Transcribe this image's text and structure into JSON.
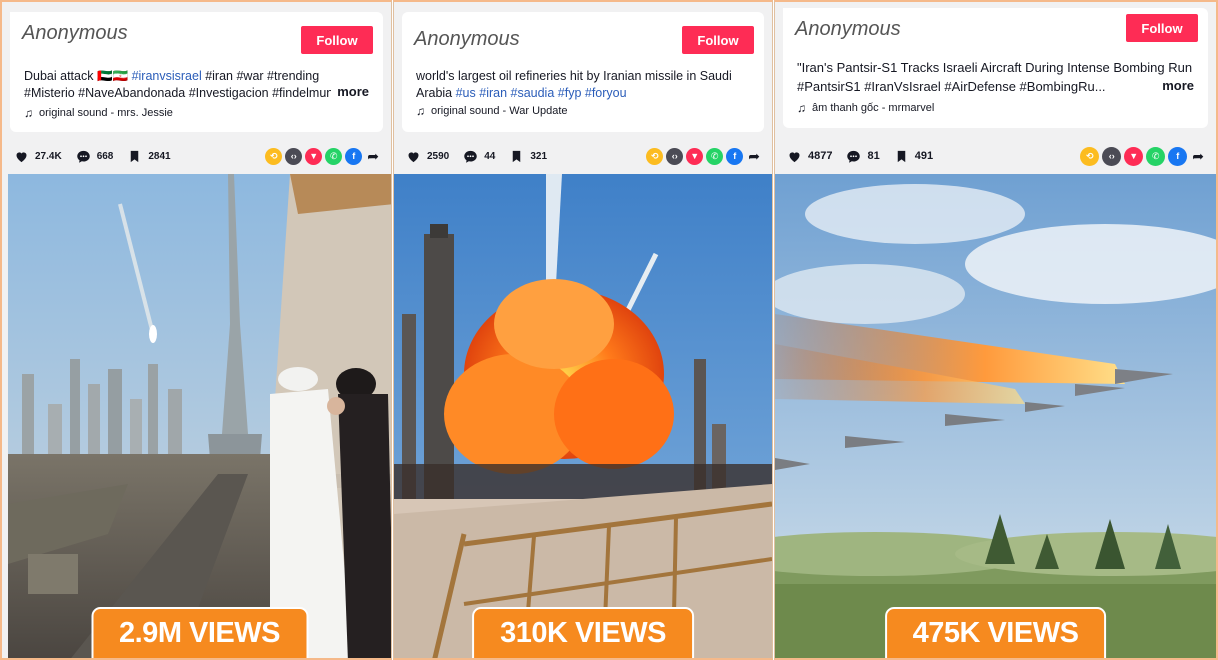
{
  "posts": [
    {
      "user": "Anonymous",
      "follow_label": "Follow",
      "caption_plain": "Dubai attack 🇦🇪🇮🇷 ",
      "caption_tag": "#iranvsisrael",
      "caption_rest": " #iran #war #trending #Misterio #NaveAbandonada #Investigacion #findelmundo...",
      "more_label": "more",
      "sound": "original sound - mrs. Jessie",
      "likes": "27.4K",
      "comments": "668",
      "saves": "2841",
      "views": "2.9M VIEWS"
    },
    {
      "user": "Anonymous",
      "follow_label": "Follow",
      "caption_plain": "world's largest oil refineries hit by Iranian missile in Saudi Arabia ",
      "caption_tag": "#us #iran #saudia #fyp #foryou",
      "caption_rest": "",
      "more_label": "",
      "sound": "original sound - War Update",
      "likes": "2590",
      "comments": "44",
      "saves": "321",
      "views": "310K VIEWS"
    },
    {
      "user": "Anonymous",
      "follow_label": "Follow",
      "caption_plain": "\"Iran's Pantsir-S1 Tracks Israeli Aircraft During Intense Bombing Run #PantsirS1 #IranVsIsrael #AirDefense #BombingRu...",
      "caption_tag": "",
      "caption_rest": "",
      "more_label": "more",
      "sound": "âm thanh gốc - mrmarvel",
      "likes": "4877",
      "comments": "81",
      "saves": "491",
      "views": "475K VIEWS"
    }
  ],
  "colors": {
    "follow": "#fe2c55",
    "views_badge": "#f68a1f",
    "hashtag": "#2b5db9",
    "border": "#f5b98a"
  },
  "share_icons": [
    "repost-icon",
    "embed-icon",
    "send-icon",
    "whatsapp-icon",
    "facebook-icon",
    "share-arrow-icon"
  ]
}
